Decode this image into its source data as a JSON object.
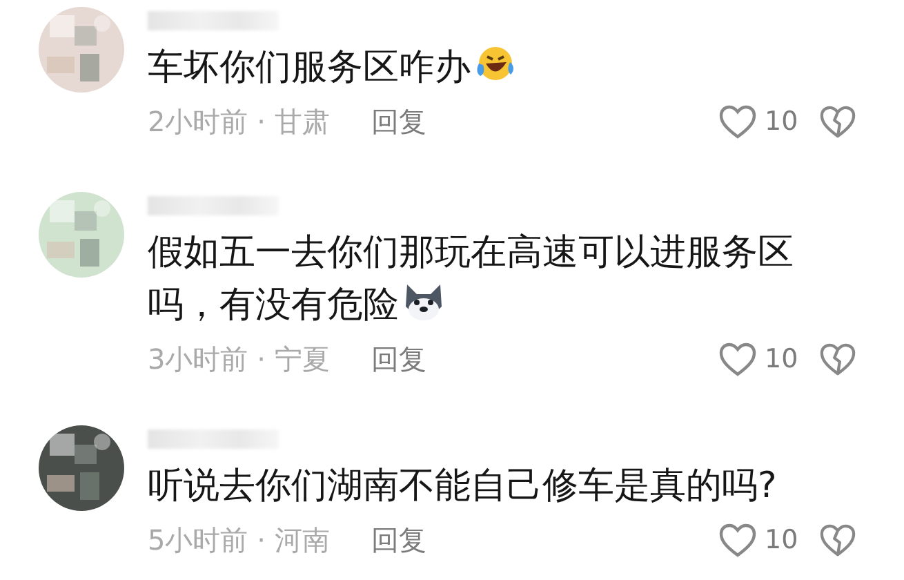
{
  "comments": [
    {
      "avatar": {
        "kind": "picture"
      },
      "text_lines": [
        "车坏你们服务区咋办"
      ],
      "emoji": {
        "kind": "laugh"
      },
      "meta": "2小时前 · 甘肃",
      "reply": "回复",
      "likes": "10"
    },
    {
      "avatar": {
        "kind": "picture"
      },
      "text_lines": [
        "假如五一去你们那玩在高速可以进服务区",
        "吗，有没有危险"
      ],
      "emoji": {
        "kind": "dog"
      },
      "meta": "3小时前 · 宁夏",
      "reply": "回复",
      "likes": "10"
    },
    {
      "avatar": {
        "kind": "picture"
      },
      "text_lines": [
        "听说去你们湖南不能自己修车是真的吗?"
      ],
      "meta": "5小时前 · 河南",
      "reply": "回复",
      "likes": "10"
    }
  ]
}
